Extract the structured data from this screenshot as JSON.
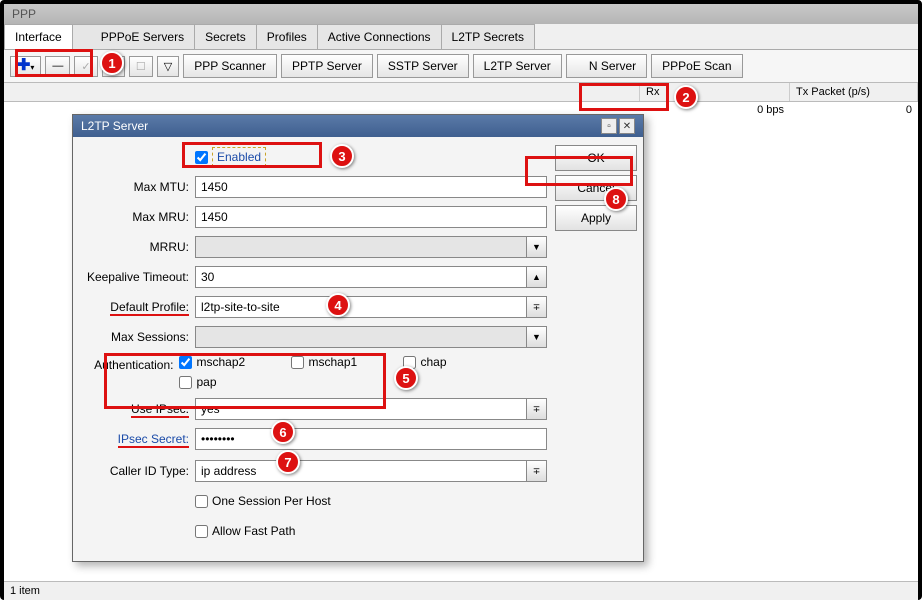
{
  "window": {
    "title": "PPP"
  },
  "tabs": [
    "Interface",
    "PPPoE Servers",
    "Secrets",
    "Profiles",
    "Active Connections",
    "L2TP Secrets"
  ],
  "toolbar": {
    "ppp_scanner": "PPP Scanner",
    "pptp_server": "PPTP Server",
    "sstp_server": "SSTP Server",
    "l2tp_server": "L2TP Server",
    "ovpn_server": "N Server",
    "pppoe_scan": "PPPoE Scan"
  },
  "grid": {
    "header_rx": "Rx",
    "header_tx_pkt": "Tx Packet (p/s)",
    "row_rx": "0 bps",
    "row_tx": "0"
  },
  "status": "1 item",
  "dialog": {
    "title": "L2TP Server",
    "enabled_label": "Enabled",
    "max_mtu_label": "Max MTU:",
    "max_mtu": "1450",
    "max_mru_label": "Max MRU:",
    "max_mru": "1450",
    "mrru_label": "MRRU:",
    "keepalive_label": "Keepalive Timeout:",
    "keepalive": "30",
    "default_profile_label": "Default Profile:",
    "default_profile": "l2tp-site-to-site",
    "max_sessions_label": "Max Sessions:",
    "auth_label": "Authentication:",
    "auth_mschap2": "mschap2",
    "auth_mschap1": "mschap1",
    "auth_chap": "chap",
    "auth_pap": "pap",
    "use_ipsec_label": "Use IPsec:",
    "use_ipsec": "yes",
    "ipsec_secret_label": "IPsec Secret:",
    "ipsec_secret": "********",
    "caller_id_label": "Caller ID Type:",
    "caller_id": "ip address",
    "one_session_label": "One Session Per Host",
    "allow_fast_label": "Allow Fast Path",
    "ok": "OK",
    "cancel": "Cancel",
    "apply": "Apply"
  },
  "callouts": {
    "1": "1",
    "2": "2",
    "3": "3",
    "4": "4",
    "5": "5",
    "6": "6",
    "7": "7",
    "8": "8"
  }
}
